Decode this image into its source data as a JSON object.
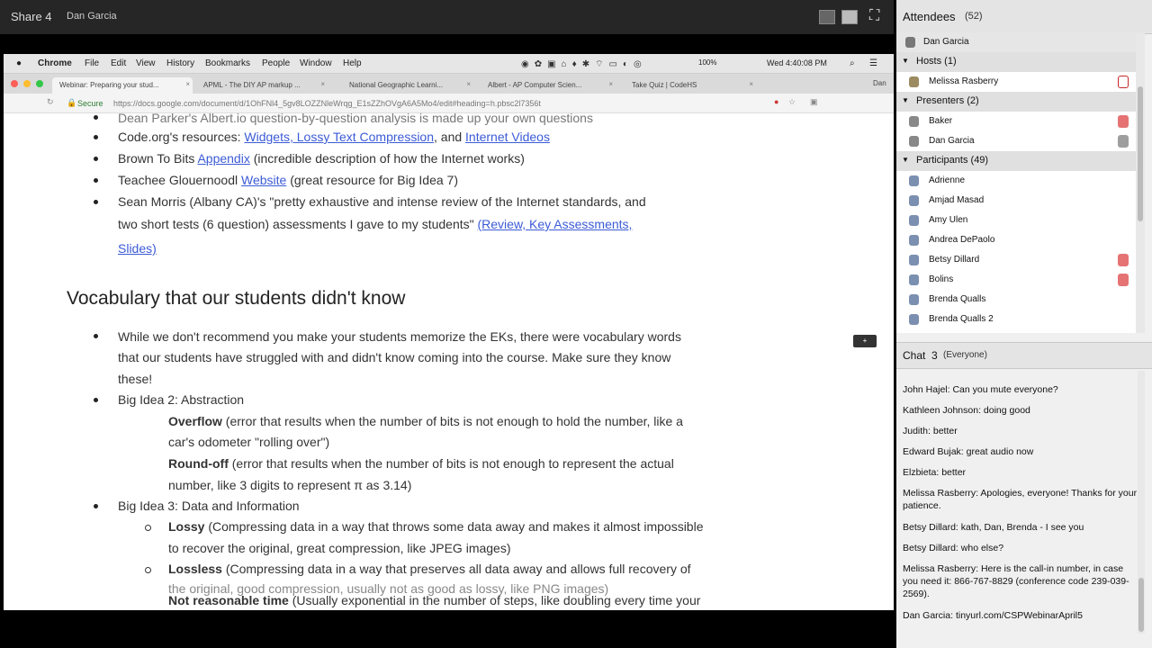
{
  "window": {
    "share_title": "Share 4",
    "presenter_name": "Dan Garcia"
  },
  "mac_menu": {
    "apple": "",
    "app": "Chrome",
    "items": [
      "File",
      "Edit",
      "View",
      "History",
      "Bookmarks",
      "People",
      "Window",
      "Help"
    ],
    "battery": "100%",
    "clock": "Wed 4:40:08 PM"
  },
  "browser": {
    "tabs": [
      {
        "label": "Webinar: Preparing your stud..."
      },
      {
        "label": "APML - The DIY AP markup ..."
      },
      {
        "label": "National Geographic Learni..."
      },
      {
        "label": "Albert - AP Computer Scien..."
      },
      {
        "label": "Take Quiz | CodeHS"
      }
    ],
    "profile": "Dan",
    "secure_label": "Secure",
    "url": "https://docs.google.com/document/d/1OhFNl4_5gv8LOZZNleWrqg_E1sZZhOVgA6A5Mo4/edit#heading=h.pbsc2l7356t"
  },
  "doc": {
    "line_top": "Dean Parker's Albert.io question-by-question analysis is made up your own questions",
    "code_org_pre": "Code.org's resources: ",
    "code_org_link1": "Widgets, Lossy Text Compression",
    "code_org_mid": ", and ",
    "code_org_link2": "Internet Videos",
    "brown_pre": "Brown To Bits ",
    "brown_link": "Appendix",
    "brown_post": " (incredible description of how the Internet works)",
    "teachee_pre": "Teachee Glouernoodl ",
    "teachee_link": "Website",
    "teachee_post": " (great resource for Big Idea 7)",
    "sean_line1": "Sean Morris (Albany CA)'s \"pretty exhaustive and intense review of the Internet standards, and",
    "sean_line2_pre": "two short tests (6 question) assessments I gave to my students\" ",
    "sean_link": "(Review, Key Assessments,",
    "sean_link2": "Slides)",
    "heading": "Vocabulary that our students didn't know",
    "vocab_line1": "While we don't recommend you make your students memorize the EKs, there were vocabulary words",
    "vocab_line2": "that our students have struggled with and didn't know coming into the course. Make sure they know",
    "vocab_line3": "these!",
    "bi2": "Big Idea 2: Abstraction",
    "overflow_term": "Overflow",
    "overflow_def1": " (error that results when the number of bits is not enough to hold the number, like a",
    "overflow_def2": "car's odometer \"rolling over\")",
    "roundoff_term": "Round-off",
    "roundoff_def1": " (error that results when the number of bits is not enough to represent the actual",
    "roundoff_def2": "number, like 3 digits to represent π as 3.14)",
    "bi3": "Big Idea 3: Data and Information",
    "lossy_term": "Lossy",
    "lossy_def1": " (Compressing data in a way that throws some data away and makes it almost impossible",
    "lossy_def2": "to recover the original, great compression, like JPEG images)",
    "lossless_term": "Lossless",
    "lossless_def1": " (Compressing data in a way that preserves all data away and allows full recovery of",
    "lossless_def2": "the original, good compression, usually not as good as lossy, like PNG images)",
    "nrt_term": "Not reasonable time",
    "nrt_def": " (Usually exponential in the number of steps, like doubling every time your"
  },
  "attendees": {
    "title": "Attendees",
    "count": "(52)",
    "me": "Dan Garcia",
    "hosts_label": "Hosts (1)",
    "hosts": [
      "Melissa Rasberry"
    ],
    "presenters_label": "Presenters (2)",
    "presenters": [
      "Baker",
      "Dan Garcia"
    ],
    "participants_label": "Participants (49)",
    "participants": [
      "Adrienne",
      "Amjad Masad",
      "Amy Ulen",
      "Andrea DePaolo",
      "Betsy Dillard",
      "Bolins",
      "Brenda Qualls",
      "Brenda Qualls 2"
    ]
  },
  "chat": {
    "title": "Chat",
    "number": "3",
    "scope": "(Everyone)",
    "messages": [
      {
        "name": "John Hajel:",
        "text": " Can you mute everyone?"
      },
      {
        "name": "Kathleen Johnson:",
        "text": " doing good"
      },
      {
        "name": "Judith:",
        "text": " better"
      },
      {
        "name": "Edward Bujak:",
        "text": " great audio now"
      },
      {
        "name": "Elzbieta:",
        "text": " better"
      },
      {
        "name": "Melissa Rasberry:",
        "text": " Apologies, everyone! Thanks for your patience."
      },
      {
        "name": "Betsy Dillard:",
        "text": " kath, Dan, Brenda - I see you"
      },
      {
        "name": "Betsy Dillard:",
        "text": " who else?"
      },
      {
        "name": "Melissa Rasberry:",
        "text": " Here is the call-in number, in case you need it: 866-767-8829 (conference code 239-039-2569)."
      },
      {
        "name": "Dan Garcia:",
        "text": " tinyurl.com/CSPWebinarApril5"
      }
    ]
  },
  "colors": {
    "accent": "#3b5bd6",
    "mute_red": "#c62828",
    "panel_bg": "#f0f0f0"
  }
}
